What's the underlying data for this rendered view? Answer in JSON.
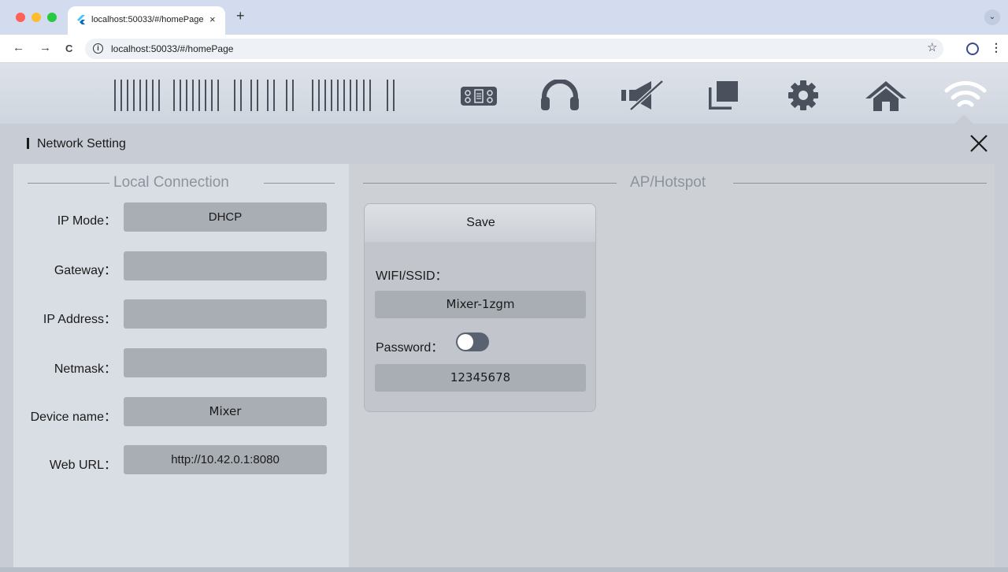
{
  "browser": {
    "tab_title": "localhost:50033/#/homePage",
    "tab_close": "×",
    "new_tab": "+",
    "tab_menu": "⌄",
    "back": "←",
    "forward": "→",
    "reload": "C",
    "info": "i",
    "url": "localhost:50033/#/homePage",
    "bookmark": "☆",
    "menu": "⋮"
  },
  "toolbar": {
    "icons": [
      "mixer-icon",
      "headphones-icon",
      "mute-icon",
      "layers-icon",
      "gear-icon",
      "home-icon",
      "wifi-icon"
    ]
  },
  "panel": {
    "title": "Network Setting",
    "close_label": "close"
  },
  "local": {
    "section_title": "Local Connection",
    "fields": [
      {
        "label": "IP Mode：",
        "value": "DHCP"
      },
      {
        "label": "Gateway：",
        "value": ""
      },
      {
        "label": "IP Address：",
        "value": ""
      },
      {
        "label": "Netmask：",
        "value": ""
      },
      {
        "label": "Device name：",
        "value": "Mixer"
      },
      {
        "label": "Web URL：",
        "value": "http://10.42.0.1:8080"
      }
    ]
  },
  "ap": {
    "section_title": "AP/Hotspot",
    "save_label": "Save",
    "ssid_label": "WIFI/SSID：",
    "ssid_value": "Mixer-1zgm",
    "password_label": "Password：",
    "password_toggle_on": false,
    "password_value": "12345678"
  },
  "colors": {
    "accent_dark": "#4a505c",
    "panel_bg": "#c8cdd5",
    "field_bg": "#a9aeb5"
  }
}
